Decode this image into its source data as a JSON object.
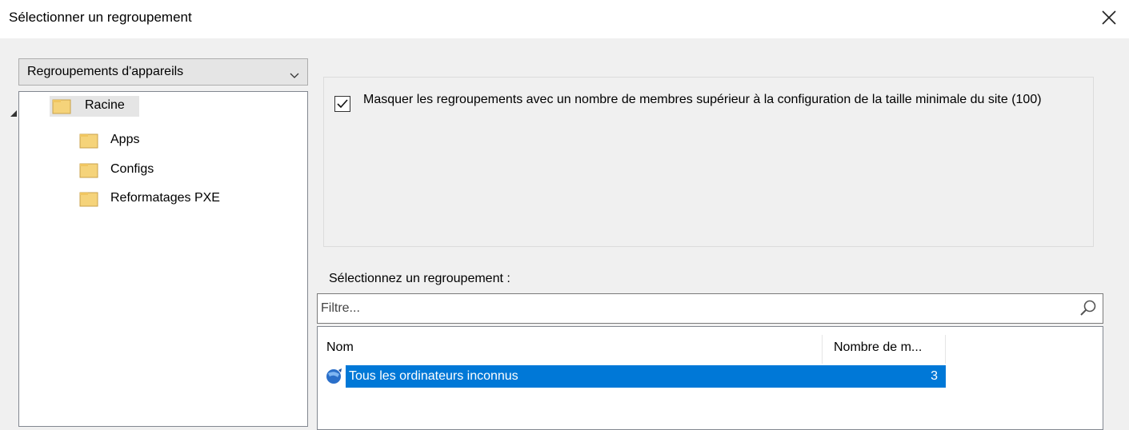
{
  "dialog": {
    "title": "Sélectionner un regroupement"
  },
  "dropdown": {
    "selected": "Regroupements d'appareils"
  },
  "tree": {
    "root": "Racine",
    "children": [
      "Apps",
      "Configs",
      "Reformatages PXE"
    ]
  },
  "options": {
    "hide_large_label": "Masquer les regroupements avec un nombre de membres supérieur à la configuration de la taille minimale du site (100)",
    "hide_large_checked": true
  },
  "selection": {
    "label": "Sélectionnez un regroupement :",
    "filter_placeholder": "Filtre...",
    "columns": [
      "Nom",
      "Nombre de m..."
    ],
    "rows": [
      {
        "name": "Tous les ordinateurs inconnus",
        "count": "3"
      }
    ]
  },
  "colors": {
    "selection": "#0078d7",
    "folder": "#f5d37a"
  },
  "icons": {
    "close": "close-icon",
    "folder": "folder-icon",
    "search": "search-icon",
    "collection": "collection-icon"
  }
}
